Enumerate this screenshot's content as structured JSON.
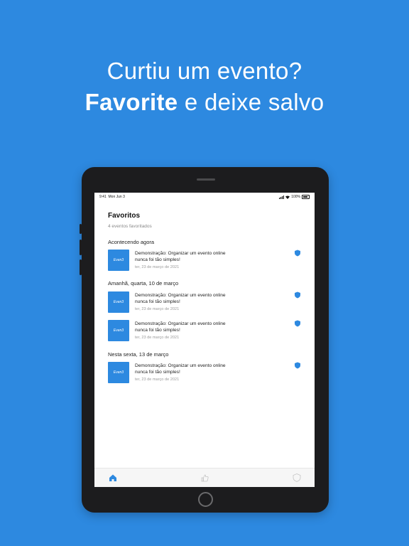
{
  "headline": {
    "line1": "Curtiu um evento?",
    "line2_bold": "Favorite",
    "line2_rest": " e deixe salvo"
  },
  "status_bar": {
    "time": "9:41",
    "date": "Mon Jun 3",
    "battery": "100%"
  },
  "page": {
    "title": "Favoritos",
    "subtitle": "4 eventos favoritados"
  },
  "sections": [
    {
      "heading": "Acontecendo agora"
    },
    {
      "heading": "Amanhã, quarta, 10 de março"
    },
    {
      "heading": "Nesta sexta, 13 de março"
    }
  ],
  "events": [
    {
      "thumb_text": "Even3",
      "title": "Demonstração: Organizar um evento online nunca foi tão simples!",
      "date": "ter, 23 de março de 2021"
    },
    {
      "thumb_text": "Even3",
      "title": "Demonstração: Organizar um evento online nunca foi tão simples!",
      "date": "ter, 23 de março de 2021"
    },
    {
      "thumb_text": "Even3",
      "title": "Demonstração: Organizar um evento online nunca foi tão simples!",
      "date": "ter, 23 de março de 2021"
    },
    {
      "thumb_text": "Even3",
      "title": "Demonstração: Organizar um evento online nunca foi tão simples!",
      "date": "ter, 23 de março de 2021"
    }
  ],
  "tabs": [
    {
      "icon": "home-icon",
      "active": true
    },
    {
      "icon": "thumb-icon",
      "active": false
    },
    {
      "icon": "shield-icon",
      "active": false
    }
  ],
  "colors": {
    "brand": "#2d89e0",
    "device": "#1c1c1e"
  }
}
